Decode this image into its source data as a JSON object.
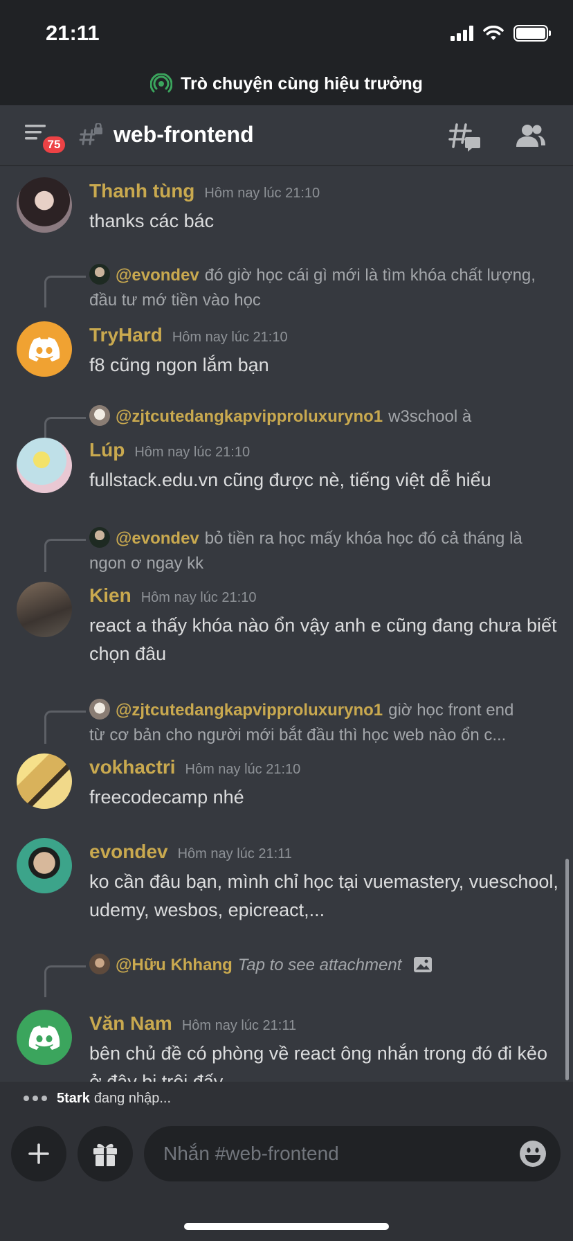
{
  "status_bar": {
    "time": "21:11"
  },
  "stage": {
    "title": "Trò chuyện cùng hiệu trưởng"
  },
  "header": {
    "badge_count": "75",
    "channel_name": "web-frontend"
  },
  "messages": [
    {
      "username": "Thanh tùng",
      "timestamp": "Hôm nay lúc 21:10",
      "text": "thanks các bác"
    },
    {
      "reply_mention": "@evondev",
      "reply_text": "đó giờ học cái gì mới là tìm khóa chất lượng, đầu tư mớ tiền vào học",
      "username": "TryHard",
      "timestamp": "Hôm nay lúc 21:10",
      "text": "f8 cũng ngon lắm bạn"
    },
    {
      "reply_mention": "@zjtcutedangkapvipproluxuryno1",
      "reply_text": "w3school à",
      "username": "Lúp",
      "timestamp": "Hôm nay lúc 21:10",
      "text": "fullstack.edu.vn cũng được nè, tiếng việt dễ hiểu"
    },
    {
      "reply_mention": "@evondev",
      "reply_text": "bỏ tiền ra học mấy khóa học đó cả tháng là ngon ơ ngay kk",
      "username": "Kien",
      "timestamp": "Hôm nay lúc 21:10",
      "text": "react a thấy khóa nào ổn vậy anh e cũng đang chưa biết chọn đâu"
    },
    {
      "reply_mention": "@zjtcutedangkapvipproluxuryno1",
      "reply_text": "giờ học front end",
      "reply_text_2": "từ cơ bản cho người mới bắt đầu thì học web nào ổn c...",
      "username": "vokhactri",
      "timestamp": "Hôm nay lúc 21:10",
      "text": "freecodecamp nhé"
    },
    {
      "username": "evondev",
      "timestamp": "Hôm nay lúc 21:11",
      "text": "ko cần đâu bạn, mình chỉ học tại vuemastery, vueschool, udemy, wesbos, epicreact,..."
    },
    {
      "reply_mention": "@Hữu Khhang",
      "reply_text": "Tap to see attachment",
      "username": "Văn Nam",
      "timestamp": "Hôm nay lúc 21:11",
      "text": "bên chủ đề có phòng về react ông nhắn trong đó đi kẻo ở đây bị trôi đấy"
    }
  ],
  "typing": {
    "user": "5tark",
    "text": "đang nhập..."
  },
  "composer": {
    "placeholder": "Nhắn #web-frontend"
  },
  "colors": {
    "background": "#36393f",
    "chrome": "#202225",
    "username": "#c9a94f",
    "badge": "#ed4245",
    "stage_icon": "#3ba55d",
    "discord_orange": "#f0a232",
    "discord_green": "#3ba55d"
  }
}
